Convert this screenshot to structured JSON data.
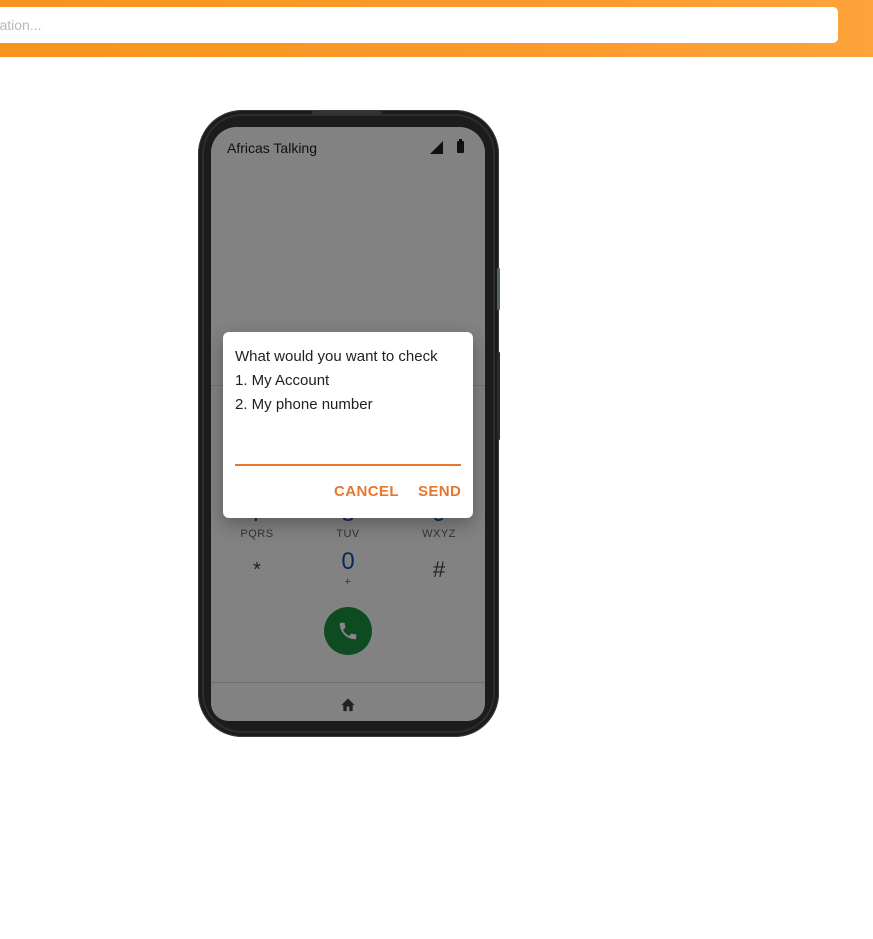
{
  "header": {
    "search_placeholder": "entation...",
    "accent_color": "#f7941d"
  },
  "phone": {
    "status_bar": {
      "carrier_title": "Africas Talking",
      "signal_icon": "cell-signal-icon",
      "battery_icon": "battery-icon"
    },
    "dialer": {
      "keys": [
        {
          "digit": "7",
          "letters": "PQRS"
        },
        {
          "digit": "8",
          "letters": "TUV"
        },
        {
          "digit": "9",
          "letters": "WXYZ"
        },
        {
          "digit": "*",
          "letters": ""
        },
        {
          "digit": "0",
          "letters": "+"
        },
        {
          "digit": "#",
          "letters": ""
        }
      ],
      "call_icon": "phone-icon",
      "call_color": "#1e8e3e"
    },
    "nav": {
      "home_icon": "home-icon"
    },
    "dialog": {
      "message_lines": [
        "What would you want to check",
        "1. My Account",
        "2. My phone number"
      ],
      "input_value": "",
      "cancel_label": "CANCEL",
      "send_label": "SEND",
      "accent_color": "#e8772e"
    }
  }
}
